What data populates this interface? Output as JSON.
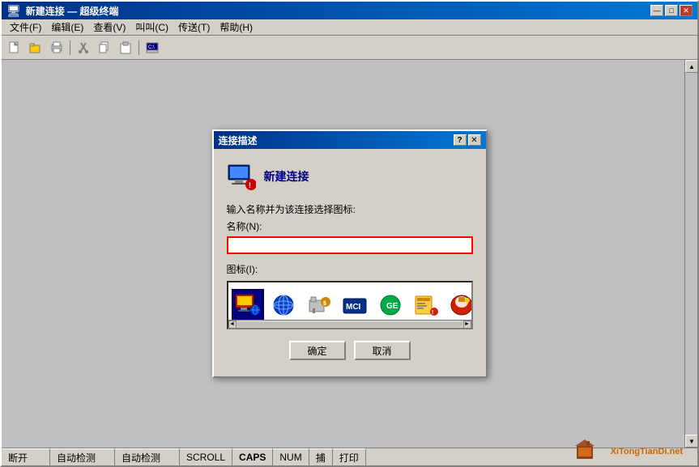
{
  "window": {
    "title": "新建连接 — 超级终端",
    "controls": {
      "minimize": "—",
      "maximize": "□",
      "close": "✕"
    }
  },
  "menu": {
    "items": [
      "文件(F)",
      "编辑(E)",
      "查看(V)",
      "叫叫(C)",
      "传送(T)",
      "帮助(H)"
    ]
  },
  "toolbar": {
    "buttons": [
      "📄",
      "📂",
      "🖨",
      "✂",
      "📋",
      "📋",
      "🖥"
    ]
  },
  "dialog": {
    "title": "连接描述",
    "help_btn": "?",
    "close_btn": "✕",
    "header_title": "新建连接",
    "prompt_text": "输入名称并为该连接选择图标:",
    "name_label": "名称(N):",
    "name_value": "",
    "icon_label": "图标(I):",
    "icons": [
      "🖥",
      "🌐",
      "📠",
      "MCI",
      "🌐",
      "📋",
      "🔐"
    ],
    "ok_label": "确定",
    "cancel_label": "取消"
  },
  "statusbar": {
    "segments": [
      "断开",
      "自动检测",
      "自动检测",
      "SCROLL",
      "CAPS",
      "NUM",
      "捕",
      "打印"
    ]
  },
  "watermark": {
    "site": "XiTongTianDi.net"
  }
}
